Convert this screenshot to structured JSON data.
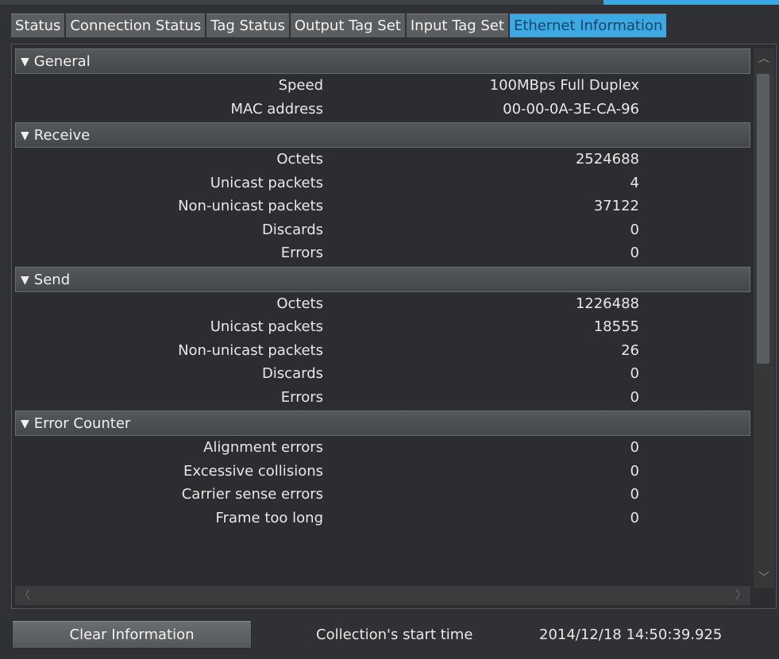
{
  "tabs": [
    "Status",
    "Connection Status",
    "Tag Status",
    "Output Tag Set",
    "Input Tag Set",
    "Ethernet Information"
  ],
  "active_tab": "Ethernet Information",
  "sections": [
    {
      "title": "General",
      "rows": [
        {
          "label": "Speed",
          "value": "100MBps Full Duplex"
        },
        {
          "label": "MAC address",
          "value": "00-00-0A-3E-CA-96"
        }
      ]
    },
    {
      "title": "Receive",
      "rows": [
        {
          "label": "Octets",
          "value": "2524688"
        },
        {
          "label": "Unicast packets",
          "value": "4"
        },
        {
          "label": "Non-unicast packets",
          "value": "37122"
        },
        {
          "label": "Discards",
          "value": "0"
        },
        {
          "label": "Errors",
          "value": "0"
        }
      ]
    },
    {
      "title": "Send",
      "rows": [
        {
          "label": "Octets",
          "value": "1226488"
        },
        {
          "label": "Unicast packets",
          "value": "18555"
        },
        {
          "label": "Non-unicast packets",
          "value": "26"
        },
        {
          "label": "Discards",
          "value": "0"
        },
        {
          "label": "Errors",
          "value": "0"
        }
      ]
    },
    {
      "title": "Error Counter",
      "rows": [
        {
          "label": "Alignment errors",
          "value": "0"
        },
        {
          "label": "Excessive collisions",
          "value": "0"
        },
        {
          "label": "Carrier sense errors",
          "value": "0"
        },
        {
          "label": "Frame too long",
          "value": "0"
        }
      ]
    }
  ],
  "footer": {
    "clear_button": "Clear Information",
    "start_time_label": "Collection's start time",
    "start_time_value": "2014/12/18 14:50:39.925"
  },
  "icons": {
    "collapse": "triangle-down-icon",
    "scroll_up": "chevron-up-icon",
    "scroll_down": "chevron-down-icon",
    "scroll_left": "chevron-left-icon",
    "scroll_right": "chevron-right-icon"
  },
  "colors": {
    "accent": "#3da9e2",
    "background": "#2f3134"
  }
}
